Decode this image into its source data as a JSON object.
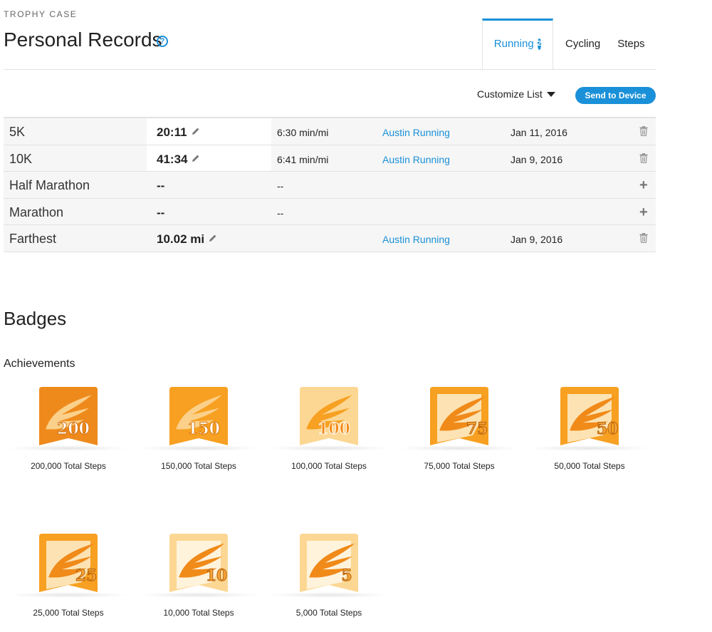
{
  "header": {
    "eyebrow": "TROPHY CASE",
    "title": "Personal Records",
    "help_icon": "question-circle-icon"
  },
  "tabs": [
    {
      "label": "Running",
      "count": "2",
      "active": true
    },
    {
      "label": "Cycling",
      "active": false
    },
    {
      "label": "Steps",
      "active": false
    }
  ],
  "toolbar": {
    "customize_label": "Customize List",
    "send_label": "Send to Device"
  },
  "records": [
    {
      "name": "5K",
      "time": "20:11",
      "pace": "6:30 min/mi",
      "activity": "Austin Running",
      "date": "Jan 11, 2016",
      "action": "trash"
    },
    {
      "name": "10K",
      "time": "41:34",
      "pace": "6:41 min/mi",
      "activity": "Austin Running",
      "date": "Jan 9, 2016",
      "action": "trash"
    },
    {
      "name": "Half Marathon",
      "time": "--",
      "pace": "--",
      "activity": "",
      "date": "",
      "action": "plus"
    },
    {
      "name": "Marathon",
      "time": "--",
      "pace": "--",
      "activity": "",
      "date": "",
      "action": "plus"
    },
    {
      "name": "Farthest",
      "time": "10.02 mi",
      "pace": "",
      "activity": "Austin Running",
      "date": "Jan 9, 2016",
      "action": "trash"
    }
  ],
  "badges_section": {
    "title": "Badges",
    "subtitle": "Achievements",
    "items": [
      {
        "number": "200",
        "label": "200,000 Total Steps",
        "style": "solid-dark"
      },
      {
        "number": "150",
        "label": "150,000 Total Steps",
        "style": "solid"
      },
      {
        "number": "100",
        "label": "100,000 Total Steps",
        "style": "light"
      },
      {
        "number": "75",
        "label": "75,000 Total Steps",
        "style": "framed"
      },
      {
        "number": "50",
        "label": "50,000 Total Steps",
        "style": "framed"
      },
      {
        "number": "25",
        "label": "25,000 Total Steps",
        "style": "framed"
      },
      {
        "number": "10",
        "label": "10,000 Total Steps",
        "style": "framed-light"
      },
      {
        "number": "5",
        "label": "5,000 Total Steps",
        "style": "framed-light"
      }
    ]
  },
  "colors": {
    "accent": "#1a90d8",
    "badge_dark": "#ee8a1c",
    "badge_mid": "#f7a021",
    "badge_light": "#fcd793"
  }
}
